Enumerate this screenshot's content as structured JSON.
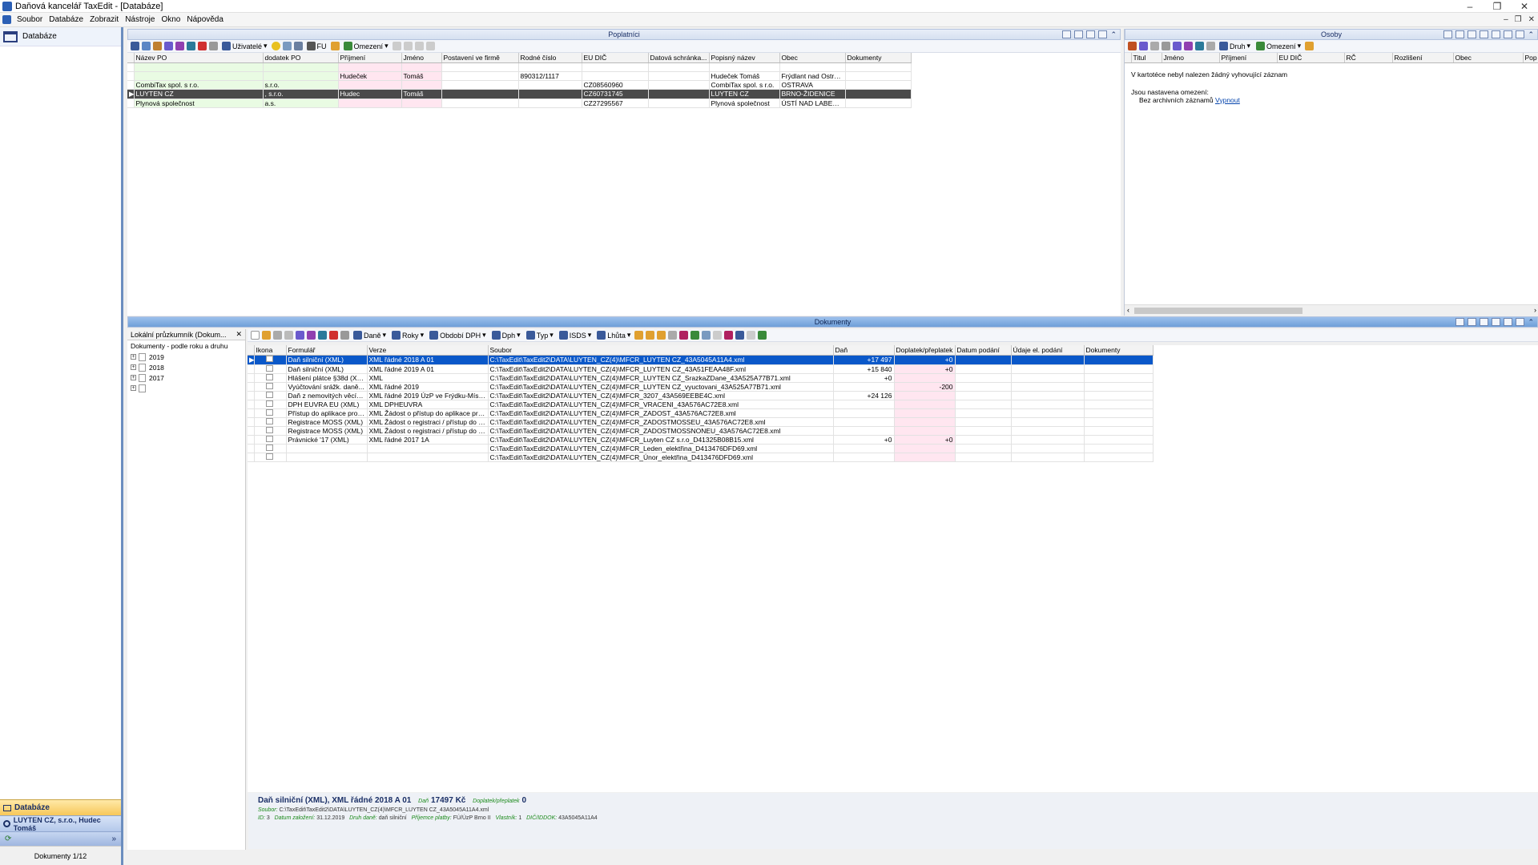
{
  "window": {
    "title": "Daňová kancelář TaxEdit - [Databáze]",
    "controls": [
      "–",
      "❐",
      "✕"
    ]
  },
  "menu": [
    "Soubor",
    "Databáze",
    "Zobrazit",
    "Nástroje",
    "Okno",
    "Nápověda"
  ],
  "left": {
    "nav_item": "Databáze",
    "bottom_db": "Databáze",
    "bottom_firm": "LUYTEN CZ, s.r.o., Hudec Tomáš",
    "status": "Dokumenty 1/12"
  },
  "poplatnici": {
    "title": "Poplatníci",
    "toolbar": {
      "users": "Uživatelé",
      "fu": "FU",
      "omezeni": "Omezení"
    },
    "columns": [
      "Název PO",
      "dodatek PO",
      "Příjmení",
      "Jméno",
      "Postavení ve firmě",
      "Rodné číslo",
      "EU DIČ",
      "Datová schránka...",
      "Popisný název",
      "Obec",
      "Dokumenty"
    ],
    "rows": [
      [
        "",
        "",
        "",
        "",
        "",
        "",
        "",
        "",
        "",
        "",
        ""
      ],
      [
        "",
        "",
        "Hudeček",
        "Tomáš",
        "",
        "890312/1117",
        "",
        "",
        "Hudeček Tomáš",
        "Frýdlant nad Ostra...",
        ""
      ],
      [
        "CombiTax spol. s r.o.",
        "s.r.o.",
        "",
        "",
        "",
        "",
        "CZ08560960",
        "",
        "CombiTax spol. s r.o.",
        "OSTRAVA",
        ""
      ],
      [
        "LUYTEN CZ",
        ", s.r.o.",
        "Hudec",
        "Tomáš",
        "",
        "",
        "CZ60731745",
        "",
        "LUYTEN CZ",
        "BRNO-ŽIDENICE",
        ""
      ],
      [
        "Plynová společnost",
        "a.s.",
        "",
        "",
        "",
        "",
        "CZ27295567",
        "",
        "Plynová společnost",
        "ÚSTÍ NAD LABEM-...",
        ""
      ]
    ]
  },
  "osoby": {
    "title": "Osoby",
    "toolbar": {
      "druh": "Druh",
      "omezeni": "Omezení"
    },
    "columns": [
      "Titul",
      "Jméno",
      "Příjmení",
      "EU DIČ",
      "RČ",
      "Rozlišení",
      "Obec",
      "Pop"
    ],
    "empty_msg": "V kartotéce nebyl nalezen žádný vyhovující záznam",
    "restrictions_label": "Jsou nastavena omezení:",
    "restriction_item": "Bez archivních záznamů",
    "restriction_link": "Vypnout"
  },
  "dokumenty": {
    "title": "Dokumenty",
    "toolbar": {
      "dane": "Daně",
      "roky": "Roky",
      "obdobi": "Období DPH",
      "dph": "Dph",
      "typ": "Typ",
      "isds": "ISDS",
      "lhuta": "Lhůta"
    },
    "columns": [
      "Ikona",
      "Formulář",
      "Verze",
      "Soubor",
      "Daň",
      "Doplatek/přeplatek",
      "Datum podání",
      "Údaje el. podání",
      "Dokumenty"
    ],
    "rows": [
      [
        "Daň silniční (XML)",
        "XML řádné 2018 A 01",
        "C:\\TaxEdit\\TaxEdit2\\DATA\\LUYTEN_CZ(4)\\MFCR_LUYTEN CZ_43A5045A11A4.xml",
        "+17 497",
        "+0"
      ],
      [
        "Daň silniční (XML)",
        "XML řádné 2019 A 01",
        "C:\\TaxEdit\\TaxEdit2\\DATA\\LUYTEN_CZ(4)\\MFCR_LUYTEN CZ_43A51FEAA48F.xml",
        "+15 840",
        "+0"
      ],
      [
        "Hlášení plátce §38d (XML)",
        "XML",
        "C:\\TaxEdit\\TaxEdit2\\DATA\\LUYTEN_CZ(4)\\MFCR_LUYTEN CZ_SrazkaZDane_43A525A77B71.xml",
        "+0",
        ""
      ],
      [
        "Vyúčtování srážk. daně...",
        "XML řádné 2019",
        "C:\\TaxEdit\\TaxEdit2\\DATA\\LUYTEN_CZ(4)\\MFCR_LUYTEN CZ_vyuctovani_43A525A77B71.xml",
        "",
        "-200"
      ],
      [
        "Daň z nemovitých věcí (...",
        "XML řádné 2019 ÚzP ve Frýdku-Místk...",
        "C:\\TaxEdit\\TaxEdit2\\DATA\\LUYTEN_CZ(4)\\MFCR_3207_43A569EEBE4C.xml",
        "+24 126",
        ""
      ],
      [
        "DPH EUVRA EU (XML)",
        "XML DPHEUVRA",
        "C:\\TaxEdit\\TaxEdit2\\DATA\\LUYTEN_CZ(4)\\MFCR_VRACENI_43A576AC72E8.xml",
        "",
        ""
      ],
      [
        "Přístup do aplikace pro ...",
        "XML Žádost o přístup do aplikace pro ...",
        "C:\\TaxEdit\\TaxEdit2\\DATA\\LUYTEN_CZ(4)\\MFCR_ZADOST_43A576AC72E8.xml",
        "",
        ""
      ],
      [
        "Registrace MOSS (XML)",
        "XML Žádost o registraci / přístup do a...",
        "C:\\TaxEdit\\TaxEdit2\\DATA\\LUYTEN_CZ(4)\\MFCR_ZADOSTMOSSEU_43A576AC72E8.xml",
        "",
        ""
      ],
      [
        "Registrace MOSS (XML)",
        "XML Žádost o registraci / přístup do a...",
        "C:\\TaxEdit\\TaxEdit2\\DATA\\LUYTEN_CZ(4)\\MFCR_ZADOSTMOSSNONEU_43A576AC72E8.xml",
        "",
        ""
      ],
      [
        "Právnické '17 (XML)",
        "XML řádné 2017 1A",
        "C:\\TaxEdit\\TaxEdit2\\DATA\\LUYTEN_CZ(4)\\MFCR_Luyten CZ s.r.o_D41325B08B15.xml",
        "+0",
        "+0"
      ],
      [
        "",
        "",
        "C:\\TaxEdit\\TaxEdit2\\DATA\\LUYTEN_CZ(4)\\MFCR_Leden_elektřina_D413476DFD69.xml",
        "",
        ""
      ],
      [
        "",
        "",
        "C:\\TaxEdit\\TaxEdit2\\DATA\\LUYTEN_CZ(4)\\MFCR_Únor_elektřina_D413476DFD69.xml",
        "",
        ""
      ]
    ]
  },
  "tree": {
    "title": "Lokální průzkumník (Dokum...",
    "root": "Dokumenty - podle roku a druhu",
    "nodes": [
      "2019",
      "2018",
      "2017",
      ""
    ]
  },
  "detail": {
    "title": "Daň silniční (XML), XML řádné 2018 A 01",
    "dan_label": "Daň",
    "dan_value": "17497 Kč",
    "doplatek_label": "Doplatek/přeplatek",
    "doplatek_value": "0",
    "soubor_label": "Soubor:",
    "soubor_value": "C:\\TaxEdit\\TaxEdit2\\DATA\\LUYTEN_CZ(4)\\MFCR_LUYTEN CZ_43A5045A11A4.xml",
    "id_label": "ID:",
    "id_value": "3",
    "datum_label": "Datum založení:",
    "datum_value": "31.12.2019",
    "druh_label": "Druh daně:",
    "druh_value": "daň silniční",
    "prijemce_label": "Příjemce platby:",
    "prijemce_value": "FÚ/ÚzP Brno II",
    "vlastnik_label": "Vlastník:",
    "vlastnik_value": "1",
    "dic_label": "DIČ/IDDOK:",
    "dic_value": "43A5045A11A4"
  }
}
